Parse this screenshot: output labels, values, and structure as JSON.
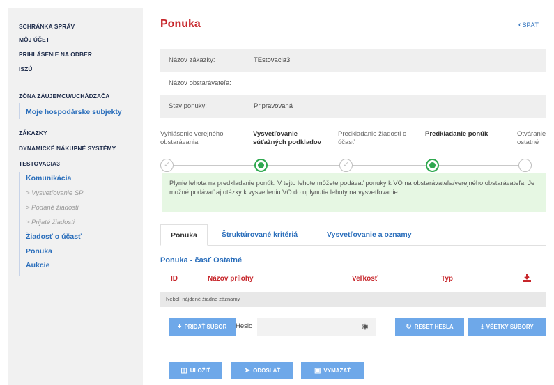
{
  "sidebar": {
    "top_links": [
      "SCHRÁNKA SPRÁV",
      "MÔJ ÚČET",
      "PRIHLÁSENIE NA ODBER",
      "ISZÚ"
    ],
    "zone_heading": "ZÓNA ZÁUJEMCU/UCHÁDZAČA",
    "zone_item": "Moje hospodárske subjekty",
    "links2": [
      "ZÁKAZKY",
      "DYNAMICKÉ NÁKUPNÉ SYSTÉMY",
      "TESTOVACIA3"
    ],
    "sub_items": [
      {
        "label": "Komunikácia",
        "style": "bold"
      },
      {
        "label": "> Vysvetľovanie SP",
        "style": "italic"
      },
      {
        "label": "> Podané žiadosti",
        "style": "italic"
      },
      {
        "label": "> Prijaté žiadosti",
        "style": "italic"
      },
      {
        "label": "Žiadosť o účasť",
        "style": "bold"
      },
      {
        "label": "Ponuka",
        "style": "bold"
      },
      {
        "label": "Aukcie",
        "style": "bold"
      }
    ]
  },
  "header": {
    "title": "Ponuka",
    "back_label": "SPÄŤ"
  },
  "info": [
    {
      "label": "Názov zákazky:",
      "value": "TEstovacia3"
    },
    {
      "label": "Názov obstarávateľa:",
      "value": ""
    },
    {
      "label": "Stav ponuky:",
      "value": "Pripravovaná"
    }
  ],
  "steps": [
    {
      "label": "Vyhlásenie verejného obstarávania",
      "state": "done"
    },
    {
      "label": "Vysvetľovanie súťažných podkladov",
      "state": "active"
    },
    {
      "label": "Predkladanie žiadosti o účasť",
      "state": "done"
    },
    {
      "label": "Predkladanie ponúk",
      "state": "active"
    },
    {
      "label": "Otváranie ostatné",
      "state": "pending"
    }
  ],
  "notice": "Plynie lehota na predkladanie ponúk. V tejto lehote môžete podávať ponuky k VO na obstarávateľa/verejného obstarávateľa. Je možné podávať aj otázky k vysvetleniu VO do uplynutia lehoty na vysvetľovanie.",
  "tabs": [
    "Ponuka",
    "Štruktúrované kritériá",
    "Vysvetľovanie a oznamy"
  ],
  "section_title": "Ponuka - časť Ostatné",
  "table": {
    "headers": [
      "ID",
      "Názov prílohy",
      "Veľkosť",
      "Typ"
    ],
    "empty_text": "Neboli nájdené žiadne záznamy"
  },
  "buttons": {
    "add_file": "PRIDAŤ SÚBOR",
    "password_label": "Heslo",
    "reset_password": "RESET HESLA",
    "all_files": "VŠETKY SÚBORY",
    "save": "ULOŽIŤ",
    "send": "ODOSLAŤ",
    "delete": "VYMAZAŤ"
  },
  "colors": {
    "accent": "#2a6ebb",
    "title_red": "#c7262b",
    "step_green": "#2fa84f",
    "button_blue": "#6ea8e9"
  }
}
